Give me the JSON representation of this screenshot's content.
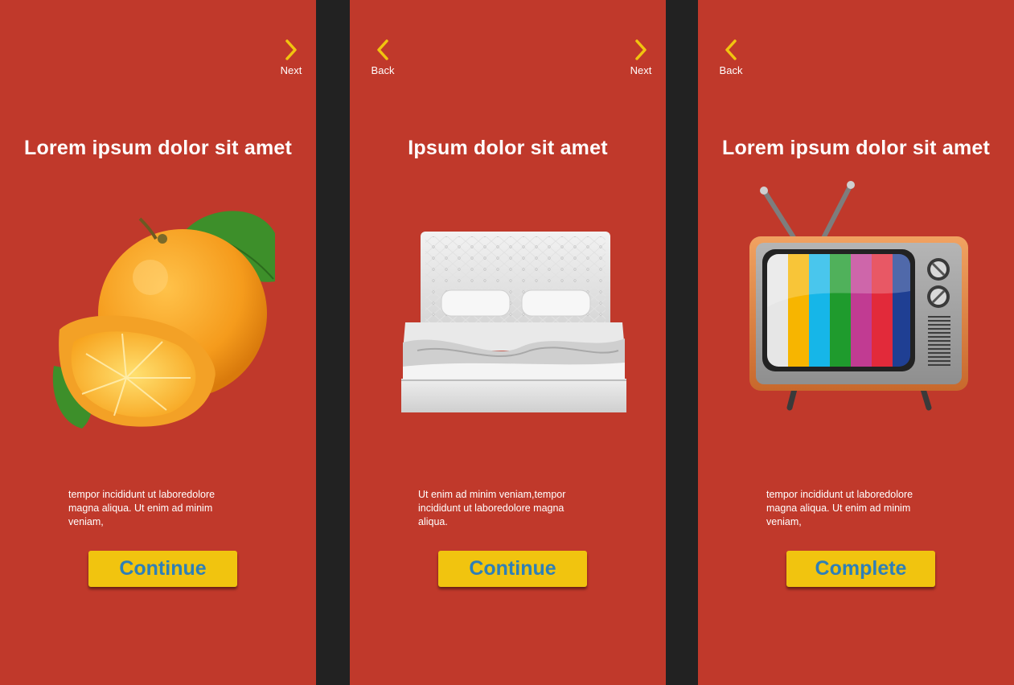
{
  "colors": {
    "panel_bg": "#c0392b",
    "divider": "#222222",
    "accent": "#f1c40f",
    "button_text": "#2e7fb8",
    "text": "#ffffff"
  },
  "screens": [
    {
      "next_label": "Next",
      "title": "Lorem ipsum dolor sit amet",
      "image": "orange-image",
      "description": "tempor incididunt ut laboredolore magna aliqua.  Ut enim ad minim veniam,",
      "button": "Continue"
    },
    {
      "back_label": "Back",
      "next_label": "Next",
      "title": "Ipsum dolor sit amet",
      "image": "bed-image",
      "description": " Ut enim ad minim veniam,tempor incididunt ut laboredolore magna aliqua.",
      "button": "Continue"
    },
    {
      "back_label": "Back",
      "title": "Lorem ipsum dolor sit amet",
      "image": "tv-image",
      "description": "tempor incididunt ut laboredolore magna aliqua.  Ut enim ad minim veniam,",
      "button": "Complete"
    }
  ]
}
